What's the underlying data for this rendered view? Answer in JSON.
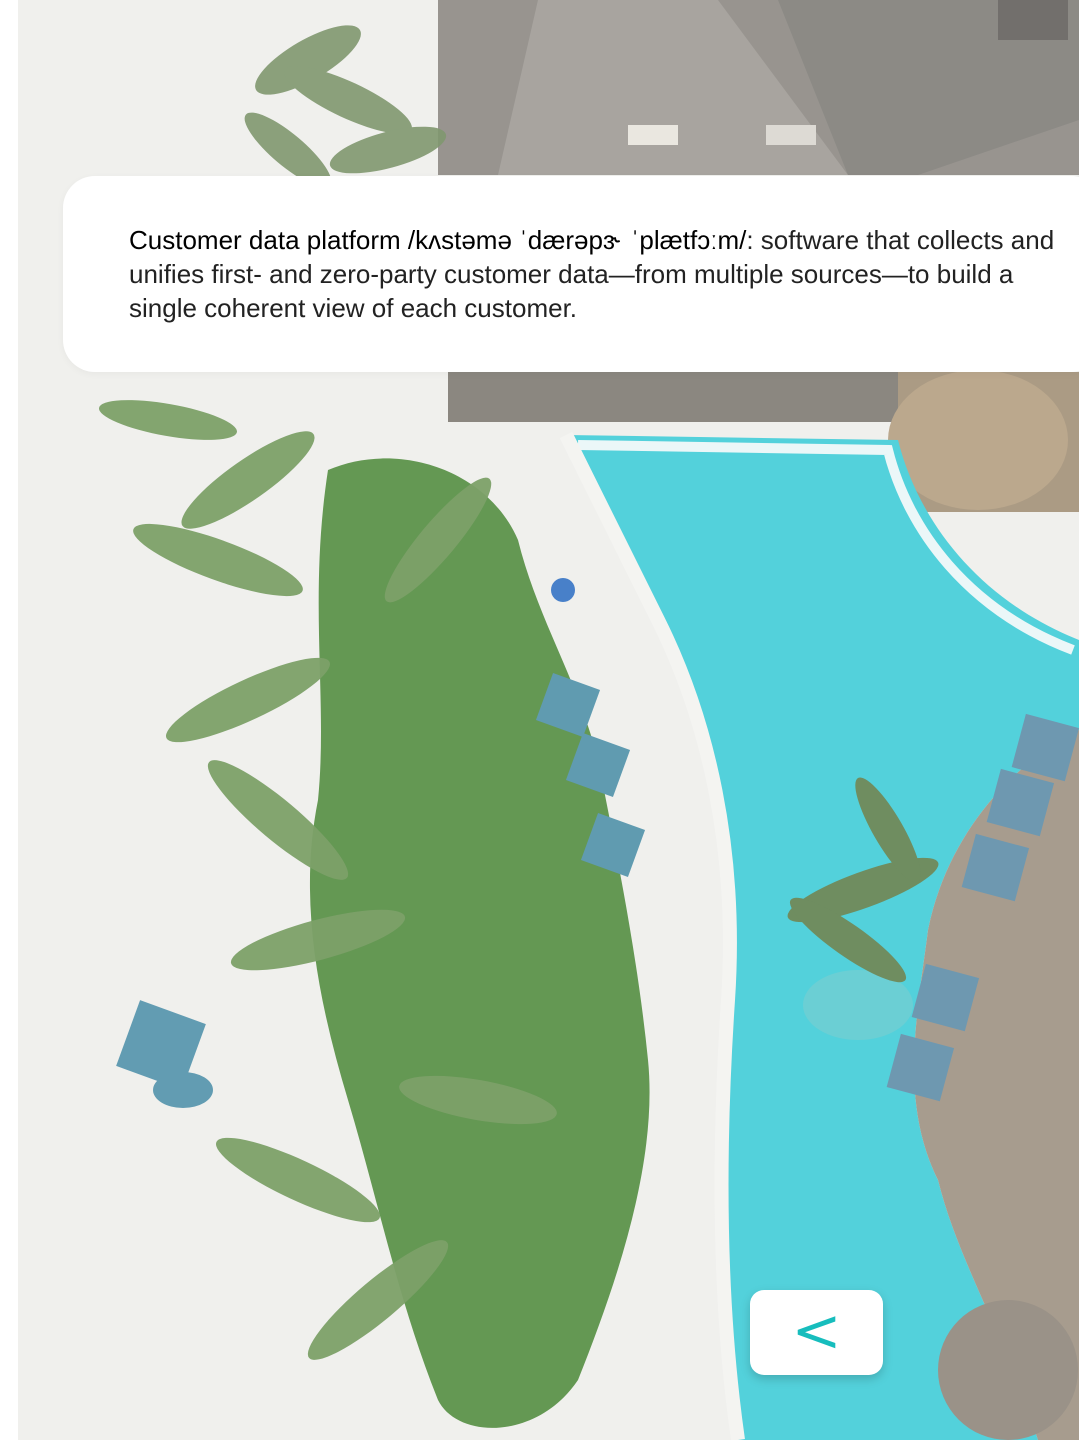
{
  "definition": {
    "term": "Customer data platform /kʌstəmə ˈdærəpɜ˞ ˈplætfɔːm/",
    "separator": ":",
    "body": " software that collects and unifies first- and zero-party customer data—from multiple sources—to build a single coherent view of each customer."
  },
  "back_button": {
    "label": "<",
    "icon": "chevron-left-icon"
  },
  "colors": {
    "accent": "#17bdbd",
    "pool": "#35cdd8",
    "sand": "#efefec",
    "card": "#ffffff"
  },
  "background_image": {
    "description": "aerial-resort-pool-beach"
  }
}
